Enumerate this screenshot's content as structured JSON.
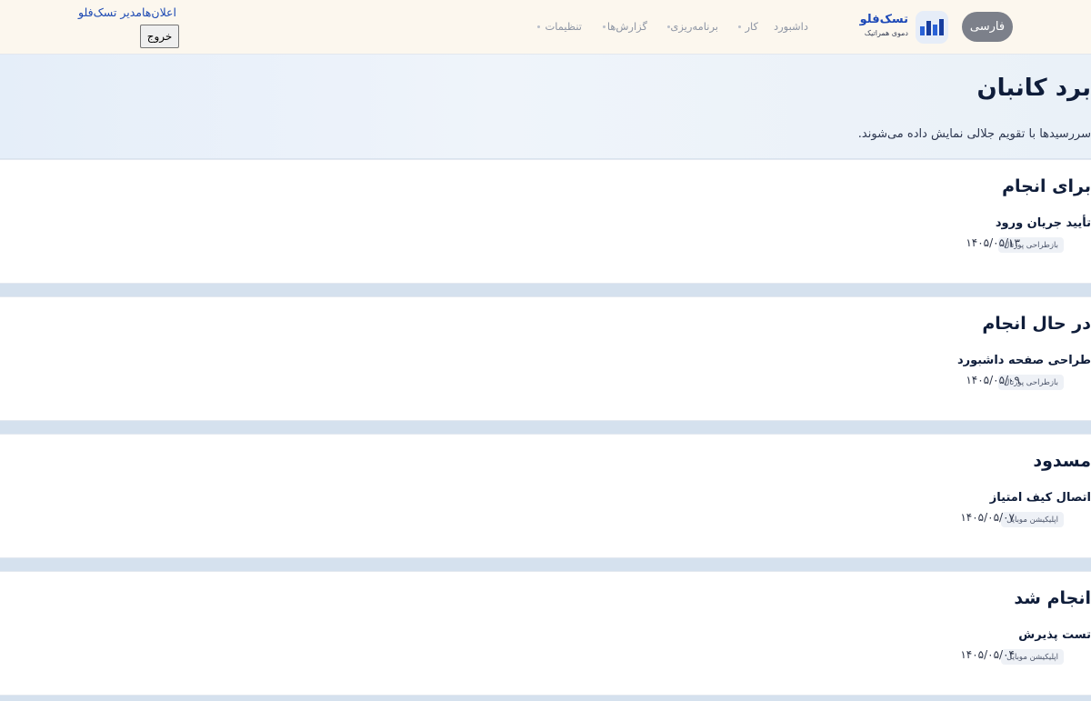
{
  "header": {
    "language": "فارسی",
    "brand_name": "تسک‌فلو",
    "brand_tagline": "دموی همراتیک",
    "nav": [
      {
        "label": "داشبورد"
      },
      {
        "label": "کار"
      },
      {
        "label": "برنامه‌ریزی"
      },
      {
        "label": "گزارش‌ها"
      },
      {
        "label": "تنظیمات"
      }
    ],
    "user_text": "اعلان‌هامدیر تسک‌فلو",
    "logout": "خروج"
  },
  "hero": {
    "title": "برد کانبان",
    "subtitle": "سررسیدها با تقویم جلالی نمایش داده می‌شوند."
  },
  "columns": [
    {
      "title": "برای انجام",
      "cards": [
        {
          "title": "تأیید جریان ورود",
          "project": "بازطراحی پورتال",
          "due": "۱۴۰۵/۰۵/۱۳"
        }
      ]
    },
    {
      "title": "در حال انجام",
      "cards": [
        {
          "title": "طراحی صفحه داشبورد",
          "project": "بازطراحی پورتال",
          "due": "۱۴۰۵/۰۵/۰۹"
        }
      ]
    },
    {
      "title": "مسدود",
      "cards": [
        {
          "title": "اتصال کیف امتیاز",
          "project": "اپلیکیشن موبایل",
          "due": "۱۴۰۵/۰۵/۰۷"
        }
      ]
    },
    {
      "title": "انجام شد",
      "cards": [
        {
          "title": "تست پذیرش",
          "project": "اپلیکیشن موبایل",
          "due": "۱۴۰۵/۰۵/۰۴"
        }
      ]
    }
  ]
}
